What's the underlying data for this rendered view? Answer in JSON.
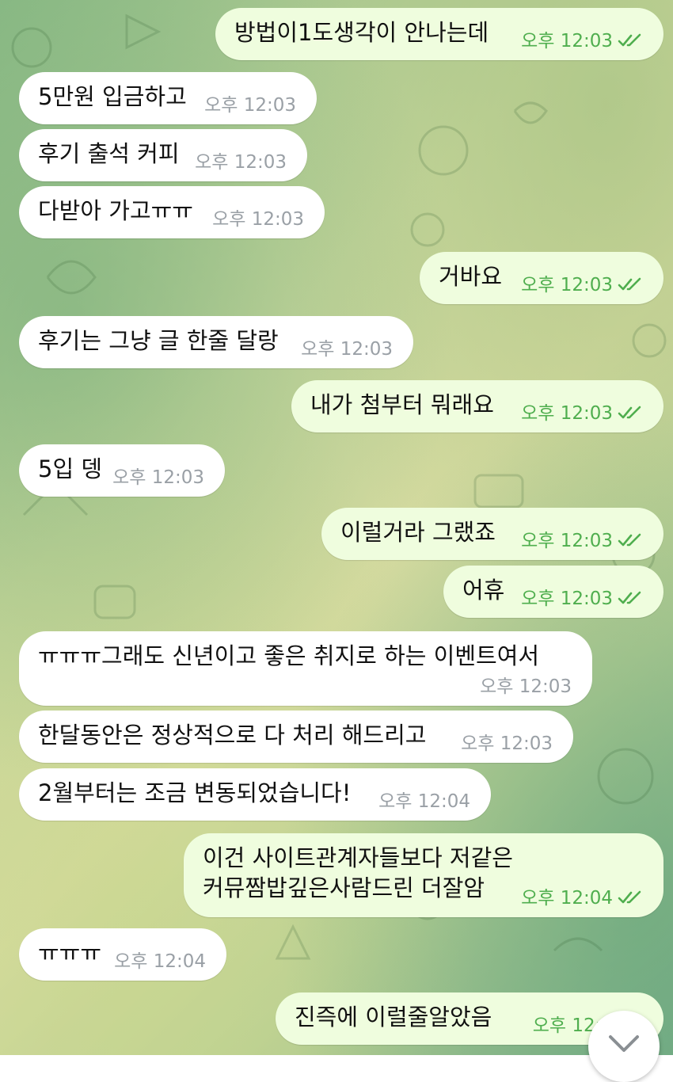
{
  "messages": [
    {
      "dir": "out",
      "text": "방법이1도생각이 안나는데",
      "time": "오후 12:03"
    },
    {
      "dir": "in",
      "text": "5만원 입금하고",
      "time": "오후 12:03"
    },
    {
      "dir": "in",
      "text": "후기 출석 커피",
      "time": "오후 12:03"
    },
    {
      "dir": "in",
      "text": "다받아 가고ㅠㅠ",
      "time": "오후 12:03"
    },
    {
      "dir": "out",
      "text": "거바요",
      "time": "오후 12:03"
    },
    {
      "dir": "in",
      "text": "후기는 그냥 글 한줄 달랑",
      "time": "오후 12:03"
    },
    {
      "dir": "out",
      "text": "내가 첨부터 뭐래요",
      "time": "오후 12:03"
    },
    {
      "dir": "in",
      "text": "5입 뎅",
      "time": "오후 12:03"
    },
    {
      "dir": "out",
      "text": "이럴거라 그랬죠",
      "time": "오후 12:03"
    },
    {
      "dir": "out",
      "text": "어휴",
      "time": "오후 12:03"
    },
    {
      "dir": "in",
      "text": "ㅠㅠㅠ그래도 신년이고 좋은 취지로 하는 이벤트여서",
      "time": "오후 12:03"
    },
    {
      "dir": "in",
      "text": "한달동안은 정상적으로 다 처리 해드리고",
      "time": "오후 12:03"
    },
    {
      "dir": "in",
      "text": "2월부터는 조금 변동되었습니다!",
      "time": "오후 12:04"
    },
    {
      "dir": "out",
      "text": "이건 사이트관계자들보다 저같은\n커뮤짬밥깊은사람드린 더잘암",
      "time": "오후 12:04"
    },
    {
      "dir": "in",
      "text": "ㅠㅠㅠ",
      "time": "오후 12:04"
    },
    {
      "dir": "out",
      "text": "진즉에 이럴줄알았음",
      "time": "오후 12:0"
    }
  ],
  "colors": {
    "incoming": "#ffffff",
    "outgoing": "#effdde",
    "time_in": "#9aa0a6",
    "time_out": "#4fae4e"
  },
  "icons": {
    "read_receipt": "double-check-icon",
    "scroll_down": "chevron-down-icon"
  }
}
